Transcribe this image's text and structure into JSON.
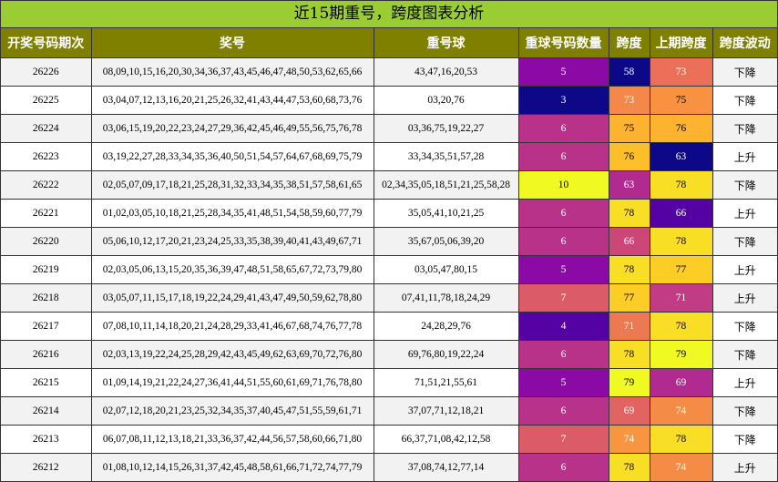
{
  "title": "近15期重号，跨度图表分析",
  "headers": [
    "开奖号码期次",
    "奖号",
    "重号球",
    "重球号码数量",
    "跨度",
    "上期跨度",
    "跨度波动"
  ],
  "colors": {
    "title_bg": "#9acd32",
    "header_bg": "#808000",
    "scale": {
      "3": "#0d0887",
      "4": "#5402a3",
      "5": "#8b0aa5",
      "6": "#b93289",
      "7": "#db5c68",
      "10": "#f0f921",
      "58": "#0d0887",
      "63": "#b12a90",
      "66": "#cc4778",
      "69": "#e16462",
      "71": "#ed7953",
      "73": "#f48849",
      "74": "#f89540",
      "75": "#fdb32f",
      "76": "#fcbf2a",
      "77": "#fccd25",
      "78": "#f8df25",
      "79": "#f0f921"
    },
    "scale_dark_text": [
      "75",
      "76",
      "77",
      "78",
      "79",
      "10"
    ],
    "prev_scale": {
      "63": "#0d0887",
      "66": "#5402a3",
      "69": "#b12a90",
      "71": "#c13c84",
      "73": "#ec7059",
      "74": "#f58c45",
      "75": "#f99240",
      "76": "#fdb32f",
      "77": "#fccd25",
      "78": "#f8df25",
      "79": "#f0f921"
    }
  },
  "rows": [
    {
      "period": "26226",
      "numbers": "08,09,10,15,16,20,30,34,36,37,43,45,46,47,48,50,53,62,65,66",
      "repeat": "43,47,16,20,53",
      "count": "5",
      "span": "58",
      "prev_span": "73",
      "wave": "下降"
    },
    {
      "period": "26225",
      "numbers": "03,04,07,12,13,16,20,21,25,26,32,41,43,44,47,53,60,68,73,76",
      "repeat": "03,20,76",
      "count": "3",
      "span": "73",
      "prev_span": "75",
      "wave": "下降"
    },
    {
      "period": "26224",
      "numbers": "03,06,15,19,20,22,23,24,27,29,36,42,45,46,49,55,56,75,76,78",
      "repeat": "03,36,75,19,22,27",
      "count": "6",
      "span": "75",
      "prev_span": "76",
      "wave": "下降"
    },
    {
      "period": "26223",
      "numbers": "03,19,22,27,28,33,34,35,36,40,50,51,54,57,64,67,68,69,75,79",
      "repeat": "33,34,35,51,57,28",
      "count": "6",
      "span": "76",
      "prev_span": "63",
      "wave": "上升"
    },
    {
      "period": "26222",
      "numbers": "02,05,07,09,17,18,21,25,28,31,32,33,34,35,38,51,57,58,61,65",
      "repeat": "02,34,35,05,18,51,21,25,58,28",
      "count": "10",
      "span": "63",
      "prev_span": "78",
      "wave": "下降"
    },
    {
      "period": "26221",
      "numbers": "01,02,03,05,10,18,21,25,28,34,35,41,48,51,54,58,59,60,77,79",
      "repeat": "35,05,41,10,21,25",
      "count": "6",
      "span": "78",
      "prev_span": "66",
      "wave": "上升"
    },
    {
      "period": "26220",
      "numbers": "05,06,10,12,17,20,21,23,24,25,33,35,38,39,40,41,43,49,67,71",
      "repeat": "35,67,05,06,39,20",
      "count": "6",
      "span": "66",
      "prev_span": "78",
      "wave": "下降"
    },
    {
      "period": "26219",
      "numbers": "02,03,05,06,13,15,20,35,36,39,47,48,51,58,65,67,72,73,79,80",
      "repeat": "03,05,47,80,15",
      "count": "5",
      "span": "78",
      "prev_span": "77",
      "wave": "上升"
    },
    {
      "period": "26218",
      "numbers": "03,05,07,11,15,17,18,19,22,24,29,41,43,47,49,50,59,62,78,80",
      "repeat": "07,41,11,78,18,24,29",
      "count": "7",
      "span": "77",
      "prev_span": "71",
      "wave": "上升"
    },
    {
      "period": "26217",
      "numbers": "07,08,10,11,14,18,20,21,24,28,29,33,41,46,67,68,74,76,77,78",
      "repeat": "24,28,29,76",
      "count": "4",
      "span": "71",
      "prev_span": "78",
      "wave": "下降"
    },
    {
      "period": "26216",
      "numbers": "02,03,13,19,22,24,25,28,29,42,43,45,49,62,63,69,70,72,76,80",
      "repeat": "69,76,80,19,22,24",
      "count": "6",
      "span": "78",
      "prev_span": "79",
      "wave": "下降"
    },
    {
      "period": "26215",
      "numbers": "01,09,14,19,21,22,24,27,36,41,44,51,55,60,61,69,71,76,78,80",
      "repeat": "71,51,21,55,61",
      "count": "5",
      "span": "79",
      "prev_span": "69",
      "wave": "上升"
    },
    {
      "period": "26214",
      "numbers": "02,07,12,18,20,21,23,25,32,34,35,37,40,45,47,51,55,59,61,71",
      "repeat": "37,07,71,12,18,21",
      "count": "6",
      "span": "69",
      "prev_span": "74",
      "wave": "下降"
    },
    {
      "period": "26213",
      "numbers": "06,07,08,11,12,13,18,21,33,36,37,42,44,56,57,58,60,66,71,80",
      "repeat": "66,37,71,08,42,12,58",
      "count": "7",
      "span": "74",
      "prev_span": "78",
      "wave": "下降"
    },
    {
      "period": "26212",
      "numbers": "01,08,10,12,14,15,26,31,37,42,45,48,58,61,66,71,72,74,77,79",
      "repeat": "37,08,74,12,77,14",
      "count": "6",
      "span": "78",
      "prev_span": "74",
      "wave": "上升"
    }
  ]
}
